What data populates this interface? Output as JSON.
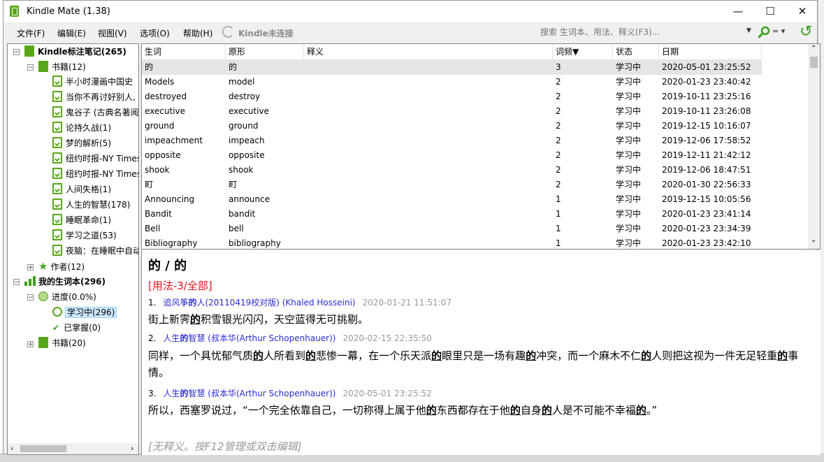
{
  "app": {
    "title": "Kindle Mate (1.38)",
    "minimize": "—",
    "maximize": "☐",
    "close": "✕"
  },
  "menu": [
    "文件(F)",
    "编辑(E)",
    "视图(V)",
    "选项(O)",
    "帮助(H)"
  ],
  "kindle_status": "Kindle未连接",
  "search": {
    "placeholder": "搜索 生词本、用法、释义(F3)...",
    "match_mode": "="
  },
  "colors": {
    "accent": "#59a61a",
    "link": "#2b2bd6",
    "usage": "#e0141e",
    "selection": "#cce8ff"
  },
  "tree": {
    "root": "Kindle标注笔记(265)",
    "books_label": "书籍(12)",
    "books": [
      "半小时漫画中国史",
      "当你不再讨好别人,",
      "鬼谷子 (古典名著阅",
      "论持久战(1)",
      "梦的解析(5)",
      "纽约时报-NY Times",
      "纽约时报-NY Times",
      "人间失格(1)",
      "人生的智慧(178)",
      "睡眠革命(1)",
      "学习之道(53)",
      "夜脑：在睡眠中自动"
    ],
    "authors_label": "作者(12)",
    "vocab_root": "我的生词本(296)",
    "progress_label": "进度(0.0%)",
    "learning_label": "学习中(296)",
    "mastered_label": "已掌握(0)",
    "vocab_books_label": "书籍(20)"
  },
  "grid": {
    "headers": {
      "word": "生词",
      "stem": "原形",
      "definition": "释义",
      "frequency": "词频▼",
      "status": "状态",
      "date": "日期"
    },
    "rows": [
      {
        "word": "的",
        "stem": "的",
        "def": "",
        "freq": "3",
        "status": "学习中",
        "date": "2020-05-01 23:25:52"
      },
      {
        "word": "Models",
        "stem": "model",
        "def": "",
        "freq": "2",
        "status": "学习中",
        "date": "2020-01-23 23:40:42"
      },
      {
        "word": "destroyed",
        "stem": "destroy",
        "def": "",
        "freq": "2",
        "status": "学习中",
        "date": "2019-10-11 23:25:16"
      },
      {
        "word": "executive",
        "stem": "executive",
        "def": "",
        "freq": "2",
        "status": "学习中",
        "date": "2019-10-11 23:26:08"
      },
      {
        "word": "ground",
        "stem": "ground",
        "def": "",
        "freq": "2",
        "status": "学习中",
        "date": "2019-12-15 10:16:07"
      },
      {
        "word": "impeachment",
        "stem": "impeach",
        "def": "",
        "freq": "2",
        "status": "学习中",
        "date": "2019-12-06 17:58:52"
      },
      {
        "word": "opposite",
        "stem": "opposite",
        "def": "",
        "freq": "2",
        "status": "学习中",
        "date": "2019-12-11 21:42:12"
      },
      {
        "word": "shook",
        "stem": "shook",
        "def": "",
        "freq": "2",
        "status": "学习中",
        "date": "2019-12-06 18:47:51"
      },
      {
        "word": "町",
        "stem": "町",
        "def": "",
        "freq": "2",
        "status": "学习中",
        "date": "2020-01-30 22:56:33"
      },
      {
        "word": "Announcing",
        "stem": "announce",
        "def": "",
        "freq": "1",
        "status": "学习中",
        "date": "2019-12-15 10:05:56"
      },
      {
        "word": "Bandit",
        "stem": "bandit",
        "def": "",
        "freq": "1",
        "status": "学习中",
        "date": "2020-01-23 23:41:14"
      },
      {
        "word": "Bell",
        "stem": "bell",
        "def": "",
        "freq": "1",
        "status": "学习中",
        "date": "2020-01-23 23:34:39"
      },
      {
        "word": "Bibliography",
        "stem": "bibliography",
        "def": "",
        "freq": "1",
        "status": "学习中",
        "date": "2020-01-23 23:42:10"
      }
    ]
  },
  "detail": {
    "headword": "的 / 的",
    "usage": "[用法-3/全部]",
    "entries": [
      {
        "num": "1.",
        "source_a": "追风筝",
        "source_hl": "的",
        "source_b": "人(20110419校对版) (Khaled Hosseini)",
        "date": "2020-01-21 11:51:07",
        "p": [
          "街上新霁",
          "的",
          "积雪银光闪闪，天空蓝得无可挑剔。"
        ]
      },
      {
        "num": "2.",
        "source_a": "人生",
        "source_hl": "的",
        "source_b": "智慧 (叔本华(Arthur Schopenhauer))",
        "date": "2020-02-15 22:35:50",
        "p": [
          "同样，一个具忧郁气质",
          "的",
          "人所看到",
          "的",
          "悲惨一幕，在一个乐天派",
          "的",
          "眼里只是一场有趣",
          "的",
          "冲突，而一个麻木不仁",
          "的",
          "人则把这视为一件无足轻重",
          "的",
          "事情。"
        ]
      },
      {
        "num": "3.",
        "source_a": "人生",
        "source_hl": "的",
        "source_b": "智慧 (叔本华(Arthur Schopenhauer))",
        "date": "2020-05-01 23:25:52",
        "p": [
          "所以，西塞罗说过，“一个完全依靠自己，一切称得上属于他",
          "的",
          "东西都存在于他",
          "的",
          "自身",
          "的",
          "人是不可能不幸福",
          "的",
          "。”"
        ]
      }
    ],
    "no_definition": "[无释义。按F12管理或双击编辑]"
  }
}
